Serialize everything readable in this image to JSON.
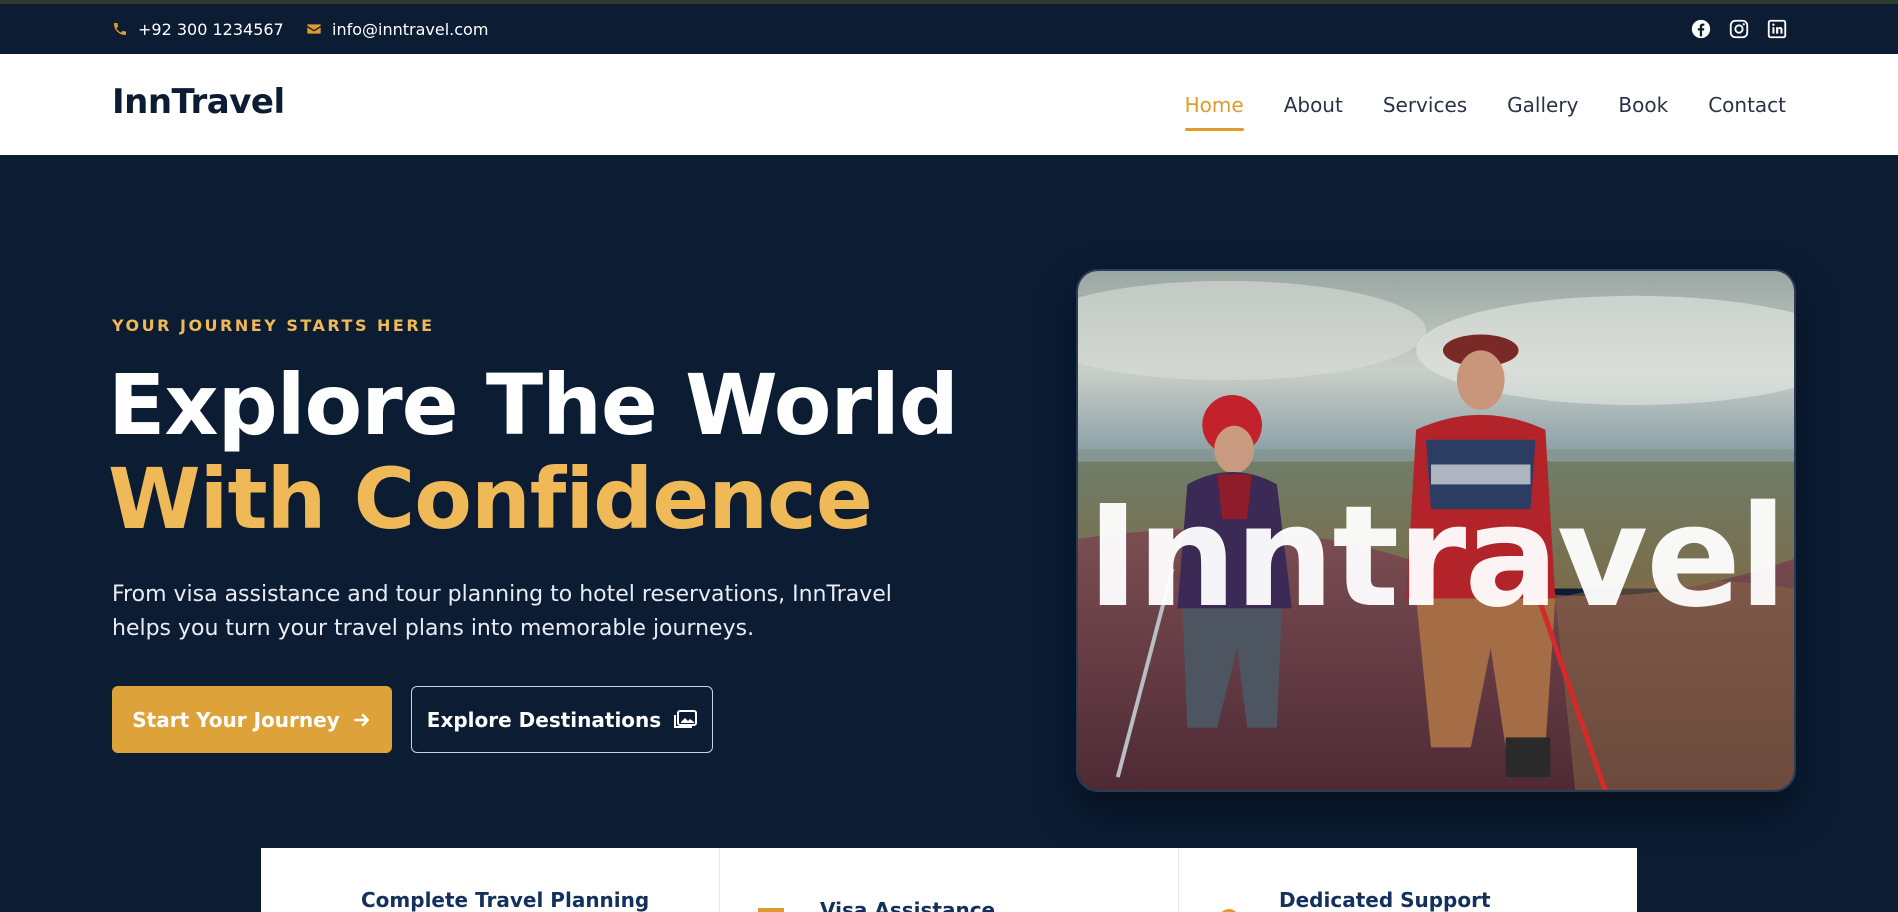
{
  "topbar": {
    "phone": "+92 300 1234567",
    "email": "info@inntravel.com",
    "socials": [
      "facebook-icon",
      "instagram-icon",
      "linkedin-icon"
    ]
  },
  "brand": {
    "logo": "InnTravel"
  },
  "nav": {
    "items": [
      {
        "label": "Home",
        "active": true
      },
      {
        "label": "About"
      },
      {
        "label": "Services"
      },
      {
        "label": "Gallery"
      },
      {
        "label": "Book"
      },
      {
        "label": "Contact"
      }
    ]
  },
  "hero": {
    "eyebrow": "YOUR JOURNEY STARTS HERE",
    "title_line1": "Explore The World",
    "title_line2": "With Confidence",
    "lead": "From visa assistance and tour planning to hotel reservations, InnTravel helps you turn your travel plans into memorable journeys.",
    "primary_button": "Start Your Journey",
    "secondary_button": "Explore Destinations",
    "image_text": "Inntravel"
  },
  "features": [
    {
      "title": "Complete Travel Planning",
      "icon": "planning-icon"
    },
    {
      "title": "Visa Assistance",
      "icon": "visa-icon"
    },
    {
      "title": "Dedicated Support",
      "icon": "support-icon"
    }
  ],
  "colors": {
    "navy": "#0b1c33",
    "gold": "#f0b957",
    "gold_button": "#dda23a",
    "nav_active": "#e09b2c"
  }
}
